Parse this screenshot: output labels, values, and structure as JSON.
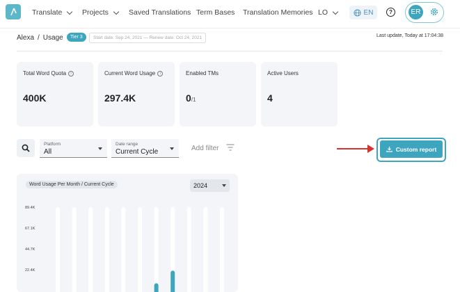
{
  "nav": {
    "items": [
      {
        "label": "Translate",
        "dropdown": true
      },
      {
        "label": "Projects",
        "dropdown": true
      },
      {
        "label": "Saved Translations",
        "dropdown": false
      },
      {
        "label": "Term Bases",
        "dropdown": false
      },
      {
        "label": "Translation Memories",
        "dropdown": false
      },
      {
        "label": "LO",
        "dropdown": true
      }
    ],
    "language": "EN",
    "help_glyph": "?",
    "avatar_initials": "ER",
    "icons": [
      "logo-icon",
      "globe-icon",
      "help-icon",
      "settings-icon"
    ]
  },
  "breadcrumb": {
    "parent": "Alexa",
    "separator": "/",
    "current": "Usage",
    "tier": "Tier 3",
    "dates": "Start date: Sep 24, 2021 — Renew date: Oct 24, 2021"
  },
  "last_update": "Last update, Today at 17:04:38",
  "cards": [
    {
      "label": "Total Word Quota",
      "value": "400K",
      "suffix": "",
      "info": true
    },
    {
      "label": "Current Word Usage",
      "value": "297.4K",
      "suffix": "",
      "info": true
    },
    {
      "label": "Enabled TMs",
      "value": "0",
      "suffix": "/1",
      "info": false
    },
    {
      "label": "Active Users",
      "value": "4",
      "suffix": "",
      "info": false
    }
  ],
  "filters": {
    "platform": {
      "label": "Platform",
      "value": "All"
    },
    "date_range": {
      "label": "Date range",
      "value": "Current Cycle"
    },
    "add_filter": "Add filter"
  },
  "custom_report": "Custom report",
  "accent_color": "#3ea5be",
  "annotation_color": "#d6332c",
  "chart": {
    "title": "Word Usage Per Month / Current Cycle",
    "year": "2024"
  },
  "chart_data": {
    "type": "bar",
    "yticks": [
      "89.4K",
      "67.1K",
      "44.7K",
      "22.4K"
    ],
    "ylim": [
      0,
      89400
    ],
    "values": [
      0,
      1000,
      0,
      1000,
      0,
      2500,
      17000,
      29000,
      1000,
      0,
      0
    ],
    "grid": false
  }
}
